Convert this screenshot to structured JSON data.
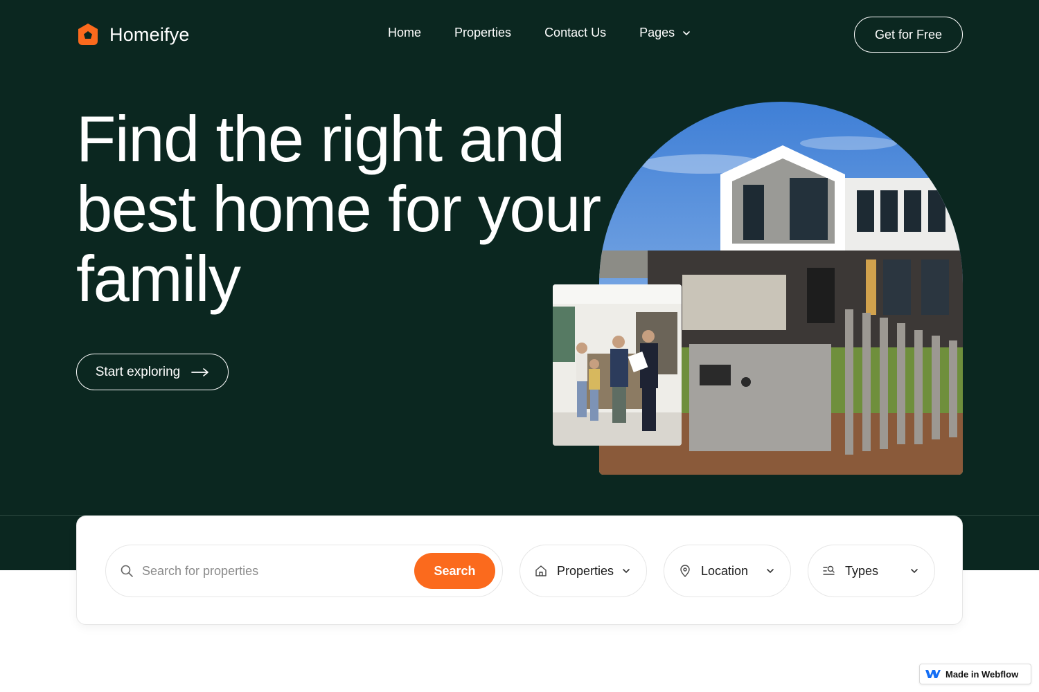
{
  "brand": {
    "name": "Homeifye",
    "accent_color": "#fb6a1d",
    "background_color": "#0b2720"
  },
  "nav": {
    "items": [
      {
        "label": "Home"
      },
      {
        "label": "Properties"
      },
      {
        "label": "Contact Us"
      },
      {
        "label": "Pages",
        "icon": "chevron-down-icon"
      }
    ],
    "cta_label": "Get for Free"
  },
  "hero": {
    "headline": "Find the right and best home for your family",
    "button_label": "Start exploring",
    "button_icon": "arrow-right-icon",
    "images": {
      "main": "modern-house-photo",
      "inset": "family-in-kitchen-photo"
    }
  },
  "search": {
    "placeholder": "Search for properties",
    "value": "",
    "button_label": "Search",
    "filters": [
      {
        "label": "Properties",
        "icon": "home-icon"
      },
      {
        "label": "Location",
        "icon": "map-pin-icon"
      },
      {
        "label": "Types",
        "icon": "filter-search-icon"
      }
    ]
  },
  "badge": {
    "label": "Made in Webflow"
  }
}
